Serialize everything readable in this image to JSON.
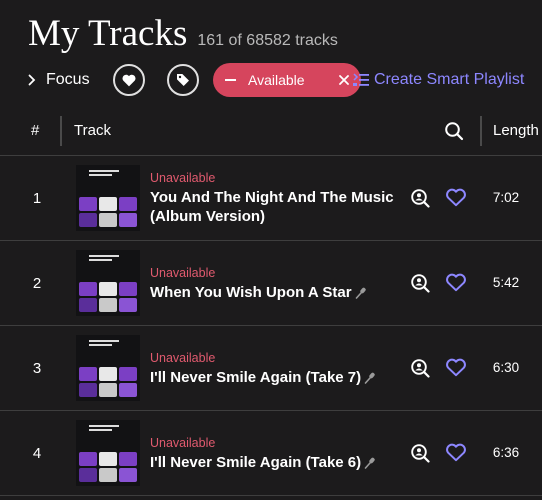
{
  "header": {
    "title": "My Tracks",
    "count": "161 of 68582 tracks"
  },
  "filters": {
    "focus_label": "Focus",
    "focus_icon": "chevron-right-icon",
    "favorites_icon": "heart-icon",
    "tags_icon": "tag-icon",
    "active_filter_label": "Available",
    "active_filter_color": "#d6455d",
    "smart_playlist_label": "Create Smart Playlist",
    "smart_playlist_color": "#8d87ff"
  },
  "columns": {
    "number": "#",
    "track": "Track",
    "search_icon": "search-icon",
    "length": "Length"
  },
  "tracks": [
    {
      "index": "1",
      "status": "Unavailable",
      "title": "You And The Night And The Music (Album Version)",
      "title_lines": [
        "You And The Night And The Music",
        "(Album Version)"
      ],
      "has_mic": false,
      "duration": "7:02"
    },
    {
      "index": "2",
      "status": "Unavailable",
      "title": "When You Wish Upon A Star",
      "title_lines": [
        "When You Wish Upon A Star"
      ],
      "has_mic": true,
      "duration": "5:42"
    },
    {
      "index": "3",
      "status": "Unavailable",
      "title": "I'll Never Smile Again (Take 7)",
      "title_lines": [
        "I'll Never Smile Again (Take 7)"
      ],
      "has_mic": true,
      "duration": "6:30"
    },
    {
      "index": "4",
      "status": "Unavailable",
      "title": "I'll Never Smile Again (Take 6)",
      "title_lines": [
        "I'll Never Smile Again (Take 6)"
      ],
      "has_mic": true,
      "duration": "6:36"
    }
  ],
  "colors": {
    "background": "#1c1b1c",
    "unavailable": "#e05a6e",
    "heart": "#8d87ff",
    "cover_accent": "#7b3fc4"
  }
}
